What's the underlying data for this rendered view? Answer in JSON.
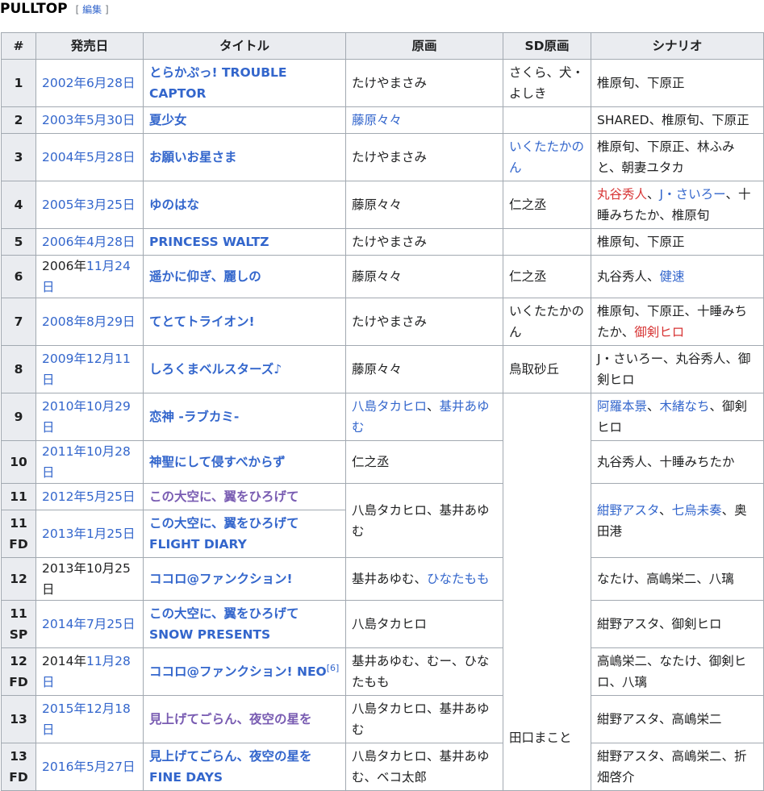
{
  "heading": {
    "title": "PULLTOP",
    "edit_open": "[ ",
    "edit_link": "編集",
    "edit_close": " ]"
  },
  "table": {
    "headers": [
      "#",
      "発売日",
      "タイトル",
      "原画",
      "SD原画",
      "シナリオ"
    ],
    "sd_shared": "田口まこと",
    "shared_cast_11": [
      {
        "t": "紺野アスタ",
        "c": "blue"
      },
      {
        "t": "、",
        "c": ""
      },
      {
        "t": "七烏未奏",
        "c": "blue"
      },
      {
        "t": "、奥田港",
        "c": ""
      }
    ],
    "shared_art_11": "八島タカヒロ、基井あゆむ",
    "rows": [
      {
        "num": "1",
        "date": [
          {
            "t": "2002年6月28日",
            "c": "blue"
          }
        ],
        "title": [
          {
            "t": "とらかぷっ! TROUBLE CAPTOR",
            "c": "blue"
          }
        ],
        "art": [
          {
            "t": "たけやまさみ",
            "c": ""
          }
        ],
        "sd": [
          {
            "t": "さくら、犬・よしき",
            "c": ""
          }
        ],
        "scenario": [
          {
            "t": "椎原旬、下原正",
            "c": ""
          }
        ]
      },
      {
        "num": "2",
        "date": [
          {
            "t": "2003年5月30日",
            "c": "blue"
          }
        ],
        "title": [
          {
            "t": "夏少女",
            "c": "blue"
          }
        ],
        "art": [
          {
            "t": "藤原々々",
            "c": "blue"
          }
        ],
        "sd": [],
        "scenario": [
          {
            "t": "SHARED、椎原旬、下原正",
            "c": ""
          }
        ]
      },
      {
        "num": "3",
        "date": [
          {
            "t": "2004年5月28日",
            "c": "blue"
          }
        ],
        "title": [
          {
            "t": "お願いお星さま",
            "c": "blue"
          }
        ],
        "art": [
          {
            "t": "たけやまさみ",
            "c": ""
          }
        ],
        "sd": [
          {
            "t": "いくたたかのん",
            "c": "blue"
          }
        ],
        "scenario": [
          {
            "t": "椎原旬、下原正、林ふみと、朝妻ユタカ",
            "c": ""
          }
        ]
      },
      {
        "num": "4",
        "date": [
          {
            "t": "2005年3月25日",
            "c": "blue"
          }
        ],
        "title": [
          {
            "t": "ゆのはな",
            "c": "blue"
          }
        ],
        "art": [
          {
            "t": "藤原々々",
            "c": ""
          }
        ],
        "sd": [
          {
            "t": "仁之丞",
            "c": ""
          }
        ],
        "scenario": [
          {
            "t": "丸谷秀人",
            "c": "red"
          },
          {
            "t": "、",
            "c": ""
          },
          {
            "t": "J・さいろー",
            "c": "blue"
          },
          {
            "t": "、十睡みちたか、椎原旬",
            "c": ""
          }
        ]
      },
      {
        "num": "5",
        "date": [
          {
            "t": "2006年4月28日",
            "c": "blue"
          }
        ],
        "title": [
          {
            "t": "PRINCESS WALTZ",
            "c": "blue"
          }
        ],
        "art": [
          {
            "t": "たけやまさみ",
            "c": ""
          }
        ],
        "sd": [],
        "scenario": [
          {
            "t": "椎原旬、下原正",
            "c": ""
          }
        ]
      },
      {
        "num": "6",
        "date": [
          {
            "t": "2006年",
            "c": ""
          },
          {
            "t": "11月24日",
            "c": "blue"
          }
        ],
        "title": [
          {
            "t": "遥かに仰ぎ、麗しの",
            "c": "blue"
          }
        ],
        "art": [
          {
            "t": "藤原々々",
            "c": ""
          }
        ],
        "sd": [
          {
            "t": "仁之丞",
            "c": ""
          }
        ],
        "scenario": [
          {
            "t": "丸谷秀人、",
            "c": ""
          },
          {
            "t": "健速",
            "c": "blue"
          }
        ]
      },
      {
        "num": "7",
        "date": [
          {
            "t": "2008年8月29日",
            "c": "blue"
          }
        ],
        "title": [
          {
            "t": "てとてトライオン!",
            "c": "blue"
          }
        ],
        "art": [
          {
            "t": "たけやまさみ",
            "c": ""
          }
        ],
        "sd": [
          {
            "t": "いくたたかのん",
            "c": ""
          }
        ],
        "scenario": [
          {
            "t": "椎原旬、下原正、十睡みちたか、",
            "c": ""
          },
          {
            "t": "御剣ヒロ",
            "c": "red"
          }
        ]
      },
      {
        "num": "8",
        "date": [
          {
            "t": "2009年12月11日",
            "c": "blue"
          }
        ],
        "title": [
          {
            "t": "しろくまベルスターズ♪",
            "c": "blue"
          }
        ],
        "art": [
          {
            "t": "藤原々々",
            "c": ""
          }
        ],
        "sd": [
          {
            "t": "鳥取砂丘",
            "c": ""
          }
        ],
        "scenario": [
          {
            "t": "J・さいろー、丸谷秀人、御剣ヒロ",
            "c": ""
          }
        ]
      },
      {
        "num": "9",
        "date": [
          {
            "t": "2010年10月29日",
            "c": "blue"
          }
        ],
        "title": [
          {
            "t": "恋神 -ラブカミ-",
            "c": "blue"
          }
        ],
        "art": [
          {
            "t": "八島タカヒロ",
            "c": "blue"
          },
          {
            "t": "、",
            "c": ""
          },
          {
            "t": "基井あゆむ",
            "c": "blue"
          }
        ],
        "scenario": [
          {
            "t": "阿羅本景",
            "c": "blue"
          },
          {
            "t": "、",
            "c": ""
          },
          {
            "t": "木緒なち",
            "c": "blue"
          },
          {
            "t": "、御剣ヒロ",
            "c": ""
          }
        ]
      },
      {
        "num": "10",
        "date": [
          {
            "t": "2011年10月28日",
            "c": "blue"
          }
        ],
        "title": [
          {
            "t": "神聖にして侵すべからず",
            "c": "blue"
          }
        ],
        "art": [
          {
            "t": "仁之丞",
            "c": ""
          }
        ],
        "scenario": [
          {
            "t": "丸谷秀人、十睡みちたか",
            "c": ""
          }
        ]
      },
      {
        "num": "11",
        "date": [
          {
            "t": "2012年5月25日",
            "c": "blue"
          }
        ],
        "title": [
          {
            "t": "この大空に、翼をひろげて",
            "c": "visited"
          }
        ]
      },
      {
        "num": "11 FD",
        "date": [
          {
            "t": "2013年1月25日",
            "c": "blue"
          }
        ],
        "title": [
          {
            "t": "この大空に、翼をひろげて FLIGHT DIARY",
            "c": "blue"
          }
        ]
      },
      {
        "num": "12",
        "date": [
          {
            "t": "2013年10月25日",
            "c": ""
          }
        ],
        "title": [
          {
            "t": "ココロ@ファンクション!",
            "c": "blue"
          }
        ],
        "art": [
          {
            "t": "基井あゆむ、",
            "c": ""
          },
          {
            "t": "ひなたもも",
            "c": "blue"
          }
        ],
        "scenario": [
          {
            "t": "なたけ、高嶋栄二、八璃",
            "c": ""
          }
        ]
      },
      {
        "num": "11 SP",
        "date": [
          {
            "t": "2014年7月25日",
            "c": "blue"
          }
        ],
        "title": [
          {
            "t": "この大空に、翼をひろげて SNOW PRESENTS",
            "c": "blue"
          }
        ],
        "art": [
          {
            "t": "八島タカヒロ",
            "c": ""
          }
        ],
        "scenario": [
          {
            "t": "紺野アスタ、御剣ヒロ",
            "c": ""
          }
        ]
      },
      {
        "num": "12 FD",
        "date": [
          {
            "t": "2014年",
            "c": ""
          },
          {
            "t": "11月28日",
            "c": "blue"
          }
        ],
        "title": [
          {
            "t": "ココロ@ファンクション! NEO",
            "c": "blue"
          }
        ],
        "title_sup": "[6]",
        "art": [
          {
            "t": "基井あゆむ、むー、ひなたもも",
            "c": ""
          }
        ],
        "scenario": [
          {
            "t": "高嶋栄二、なたけ、御剣ヒロ、八璃",
            "c": ""
          }
        ]
      },
      {
        "num": "13",
        "date": [
          {
            "t": "2015年12月18日",
            "c": "blue"
          }
        ],
        "title": [
          {
            "t": "見上げてごらん、夜空の星を",
            "c": "visited"
          }
        ],
        "art": [
          {
            "t": "八島タカヒロ、基井あゆむ",
            "c": ""
          }
        ],
        "scenario": [
          {
            "t": "紺野アスタ、高嶋栄二",
            "c": ""
          }
        ]
      },
      {
        "num": "13 FD",
        "date": [
          {
            "t": "2016年5月27日",
            "c": "blue"
          }
        ],
        "title": [
          {
            "t": "見上げてごらん、夜空の星を FINE DAYS",
            "c": "blue"
          }
        ],
        "art": [
          {
            "t": "八島タカヒロ、基井あゆむ、ベコ太郎",
            "c": ""
          }
        ],
        "scenario": [
          {
            "t": "紺野アスタ、高嶋栄二、折畑啓介",
            "c": ""
          }
        ]
      }
    ]
  }
}
